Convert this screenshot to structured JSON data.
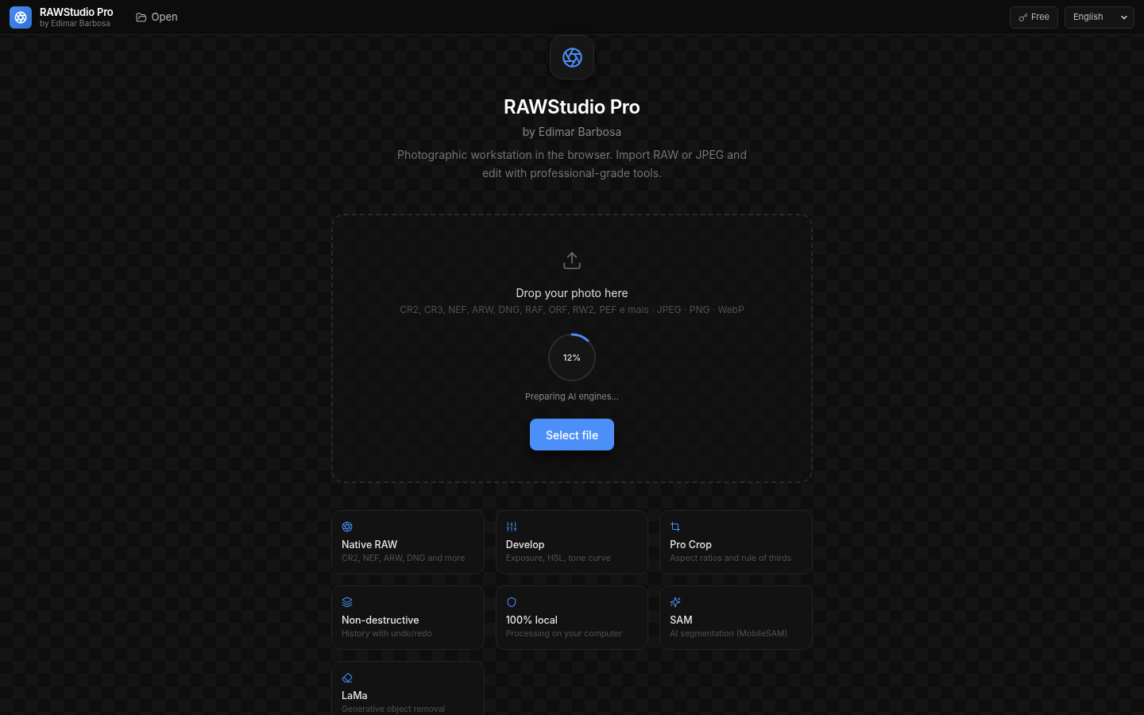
{
  "header": {
    "app_title": "RAWStudio Pro",
    "app_subtitle": "by Edimar Barbosa",
    "open_button": "Open",
    "plan_button": "Free",
    "language_select": "English"
  },
  "hero": {
    "title": "RAWStudio Pro",
    "subtitle": "by Edimar Barbosa",
    "description": "Photographic workstation in the browser. Import RAW or JPEG and edit with professional-grade tools."
  },
  "dropzone": {
    "heading": "Drop your photo here",
    "formats": "CR2, CR3, NEF, ARW, DNG, RAF, ORF, RW2, PEF e mais · JPEG · PNG · WebP",
    "progress": {
      "level": 0.12,
      "reading": "12%",
      "status": "Preparing AI engines..."
    },
    "button": "Select file"
  },
  "features": [
    {
      "title": "Native RAW",
      "description": "CR2, NEF, ARW, DNG and more"
    },
    {
      "title": "Develop",
      "description": "Exposure, HSL, tone curve"
    },
    {
      "title": "Pro Crop",
      "description": "Aspect ratios and rule of thirds"
    },
    {
      "title": "Non-destructive",
      "description": "History with undo/redo"
    },
    {
      "title": "100% local",
      "description": "Processing on your computer"
    },
    {
      "title": "SAM",
      "description": "AI segmentation (MobileSAM)"
    },
    {
      "title": "LaMa",
      "description": "Generative object removal"
    }
  ]
}
